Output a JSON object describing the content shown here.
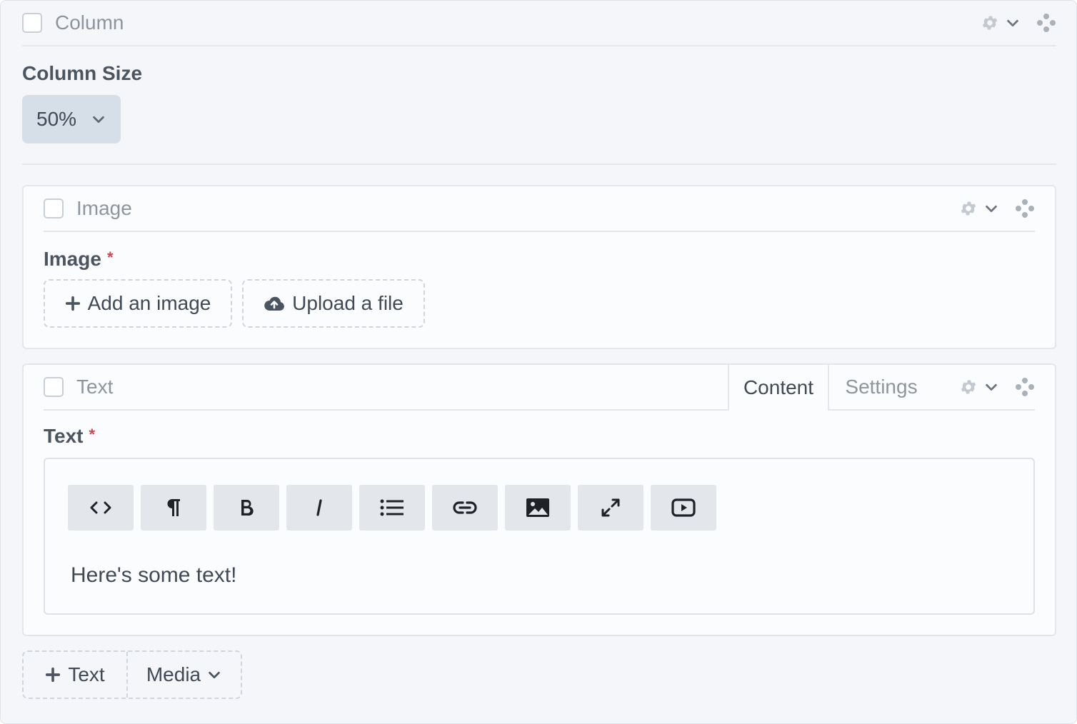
{
  "column_block": {
    "title": "Column",
    "field_label": "Column Size",
    "size_value": "50%"
  },
  "image_block": {
    "title": "Image",
    "field_label": "Image",
    "required_mark": "*",
    "add_image_label": "Add an image",
    "upload_label": "Upload a file"
  },
  "text_block": {
    "title": "Text",
    "tabs": [
      {
        "label": "Content"
      },
      {
        "label": "Settings"
      }
    ],
    "field_label": "Text",
    "required_mark": "*",
    "toolbar": [
      {
        "icon": "code-icon"
      },
      {
        "icon": "paragraph-icon"
      },
      {
        "icon": "bold-icon"
      },
      {
        "icon": "italic-icon"
      },
      {
        "icon": "list-icon"
      },
      {
        "icon": "link-icon"
      },
      {
        "icon": "image-icon"
      },
      {
        "icon": "expand-icon"
      },
      {
        "icon": "video-icon"
      }
    ],
    "content": "Here's some text!"
  },
  "add_bar": {
    "text_label": "Text",
    "media_label": "Media"
  },
  "colors": {
    "background": "#f4f6fa",
    "card": "#fbfcfd",
    "border": "#e3e7ec",
    "required": "#d9414b",
    "select_bg": "#d6dee8"
  }
}
